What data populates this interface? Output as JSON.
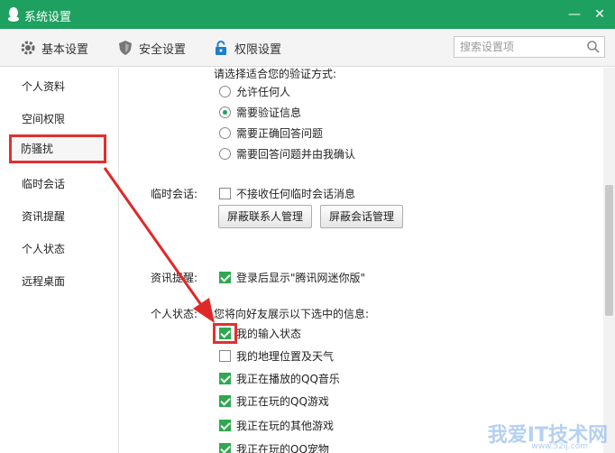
{
  "window": {
    "title": "系统设置"
  },
  "toolbar": {
    "tabs": [
      {
        "label": "基本设置",
        "icon": "gear-icon"
      },
      {
        "label": "安全设置",
        "icon": "shield-icon"
      },
      {
        "label": "权限设置",
        "icon": "lock-icon"
      }
    ],
    "search_placeholder": "搜索设置项"
  },
  "sidebar": {
    "items": [
      {
        "label": "个人资料"
      },
      {
        "label": "空间权限"
      },
      {
        "label": "防骚扰",
        "active": true
      },
      {
        "label": "临时会话"
      },
      {
        "label": "资讯提醒"
      },
      {
        "label": "个人状态"
      },
      {
        "label": "远程桌面"
      }
    ]
  },
  "verify": {
    "prompt": "请选择适合您的验证方式:",
    "options": [
      "允许任何人",
      "需要验证信息",
      "需要正确回答问题",
      "需要回答问题并由我确认"
    ],
    "selected": 1
  },
  "temp_session": {
    "label": "临时会话:",
    "option": "不接收任何临时会话消息",
    "btn_contacts": "屏蔽联系人管理",
    "btn_sessions": "屏蔽会话管理"
  },
  "news": {
    "label": "资讯提醒:",
    "option": "登录后显示\"腾讯网迷你版\""
  },
  "status": {
    "label": "个人状态:",
    "prompt": "您将向好友展示以下选中的信息:",
    "options": [
      {
        "text": "我的输入状态",
        "checked": true
      },
      {
        "text": "我的地理位置及天气",
        "checked": false
      },
      {
        "text": "我正在播放的QQ音乐",
        "checked": true
      },
      {
        "text": "我正在玩的QQ游戏",
        "checked": true
      },
      {
        "text": "我正在玩的其他游戏",
        "checked": true
      },
      {
        "text": "我正在玩的QQ宠物",
        "checked": true
      }
    ]
  },
  "watermark": {
    "text": "我爱IT技术网",
    "sub": "www.52ij.com"
  },
  "colors": {
    "titlebar": "#1ea160",
    "accent": "#2fa84f",
    "highlight": "#e03030"
  }
}
